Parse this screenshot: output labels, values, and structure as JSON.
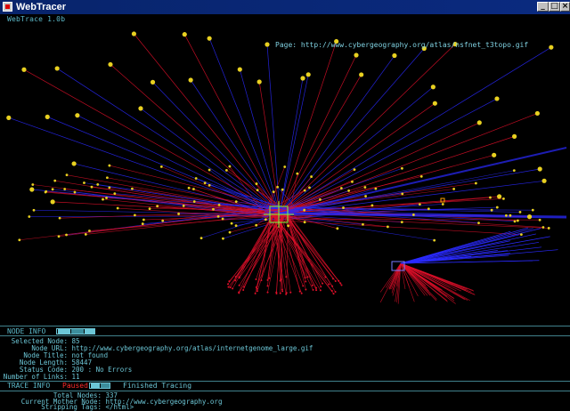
{
  "window": {
    "title": "WebTracer",
    "version": "WebTrace 1.0b",
    "buttons": {
      "minimize": "_",
      "maximize": "□",
      "close": "×"
    }
  },
  "visualization": {
    "page_label": "Page: http://www.cybergeography.org/atlas/nsfnet_t3topo.gif",
    "colors": {
      "link_red": "#e0102a",
      "link_blue": "#2a2aff",
      "node_yellow": "#e8d020",
      "highlight": "#7aff3a",
      "cursor": "#ffa000"
    }
  },
  "node_info": {
    "header": "NODE INFO",
    "rows": [
      {
        "label": "Selected Node:",
        "value": "85"
      },
      {
        "label": "Node URL:",
        "value": "http://www.cybergeography.org/atlas/internetgenome_large.gif"
      },
      {
        "label": "Node Title:",
        "value": "not found"
      },
      {
        "label": "Node Length:",
        "value": "58447"
      },
      {
        "label": "Status Code:",
        "value": "200  : No Errors"
      },
      {
        "label": "Number of Links:",
        "value": "11"
      }
    ]
  },
  "trace_info": {
    "header": "TRACE INFO",
    "status_paused": "Paused",
    "status_finished": "Finished Tracing",
    "rows": [
      {
        "label": "Total Nodes:",
        "value": "337"
      },
      {
        "label": "Current Mother Node:",
        "value": "http://www.cybergeography.org"
      },
      {
        "label": "Stripping Tags:",
        "value": "</html>"
      }
    ]
  }
}
